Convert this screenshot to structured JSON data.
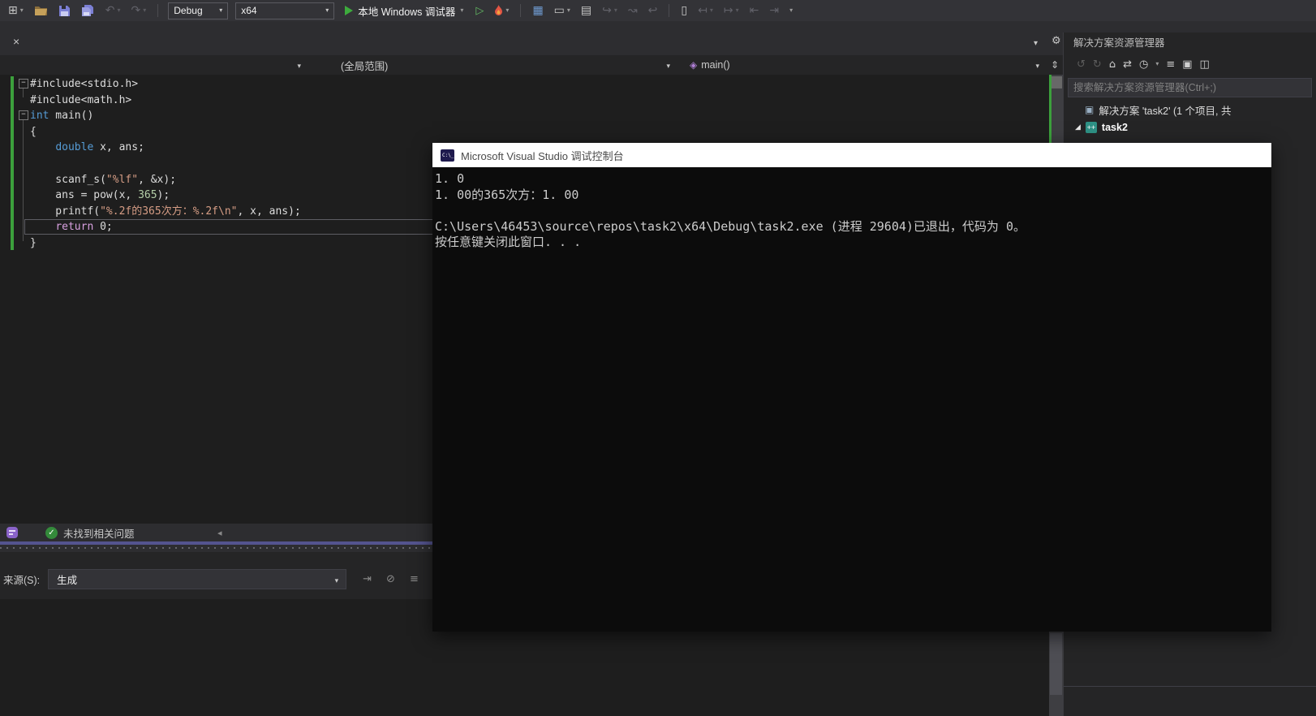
{
  "toolbar": {
    "debug_config": "Debug",
    "platform": "x64",
    "start_label": "本地 Windows 调试器"
  },
  "navbar": {
    "scope": "(全局范围)",
    "member": "main()"
  },
  "editor": {
    "lines": [
      {
        "tokens": [
          {
            "t": "#include<stdio.h>"
          }
        ]
      },
      {
        "tokens": [
          {
            "t": "#include<math.h>"
          }
        ]
      },
      {
        "tokens": [
          {
            "t": "int"
          },
          {
            "t": " main()"
          }
        ]
      },
      {
        "tokens": [
          {
            "t": "{"
          }
        ]
      },
      {
        "tokens": [
          {
            "t": "    "
          },
          {
            "t": "double"
          },
          {
            "t": " x, ans;"
          }
        ]
      },
      {
        "tokens": []
      },
      {
        "tokens": [
          {
            "t": "    scanf_s("
          },
          {
            "t": "\"%lf\""
          },
          {
            "t": ", &x);"
          }
        ]
      },
      {
        "tokens": [
          {
            "t": "    ans = pow(x, "
          },
          {
            "t": "365"
          },
          {
            "t": ");"
          }
        ]
      },
      {
        "tokens": [
          {
            "t": "    printf("
          },
          {
            "t": "\"%.2f的365次方：%.2f\\n\""
          },
          {
            "t": ", x, ans);"
          }
        ]
      },
      {
        "tokens": [
          {
            "t": "    "
          },
          {
            "t": "return"
          },
          {
            "t": " 0;"
          }
        ]
      },
      {
        "tokens": [
          {
            "t": "}"
          }
        ]
      }
    ]
  },
  "health": {
    "message": "未找到相关问题"
  },
  "output": {
    "source_label": "来源(S):",
    "source_value": "生成"
  },
  "console": {
    "title": "Microsoft Visual Studio 调试控制台",
    "lines": [
      "1. 0",
      "1. 00的365次方：1. 00",
      "",
      "C:\\Users\\46453\\source\\repos\\task2\\x64\\Debug\\task2.exe (进程 29604)已退出，代码为 0。",
      "按任意键关闭此窗口. . ."
    ]
  },
  "solution_explorer": {
    "title": "解决方案资源管理器",
    "search_placeholder": "搜索解决方案资源管理器(Ctrl+;)",
    "solution_label": "解决方案 'task2' (1 个项目, 共",
    "project_label": "task2"
  },
  "icons": {
    "minus": "−",
    "new_window": "⊞",
    "undo": "↶",
    "redo": "↷",
    "play_outline": "▷",
    "rows": "▦",
    "screen": "▭",
    "layout": "▤",
    "step_in": "↪",
    "step_over": "↝",
    "step_out": "↩",
    "bookmark": "▯",
    "nav_prev": "↤",
    "nav_next": "↦",
    "nav_first": "⇤",
    "nav_last": "⇥",
    "chevron": "▾",
    "close": "×",
    "gear": "⚙",
    "split": "⇕",
    "cube": "◈",
    "back": "↺",
    "forward": "↻",
    "home": "⌂",
    "sync": "⇄",
    "clock": "◷",
    "list": "≡",
    "collapse_all": "▣",
    "preview": "◫",
    "expander": "◢",
    "solution": "▣",
    "scroll_left": "◂",
    "check": "✓",
    "clear": "⊘",
    "cmd": "C:\\_",
    "cpp": "++"
  }
}
